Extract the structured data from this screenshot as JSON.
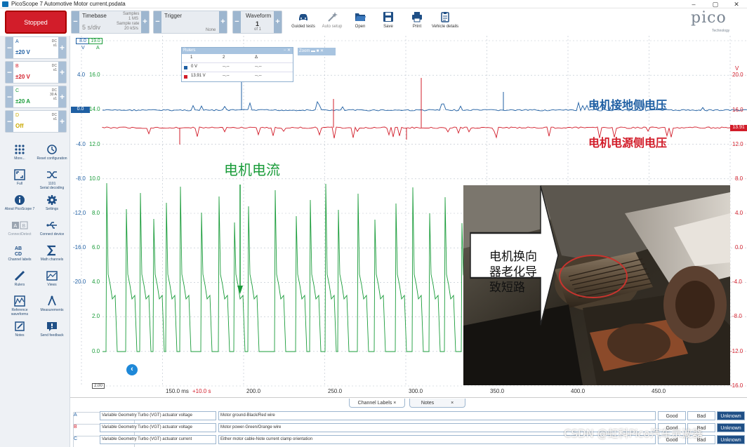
{
  "window": {
    "title": "PicoScope 7 Automotive Motor current.psdata",
    "minimize": "–",
    "maximize": "▢",
    "close": "✕"
  },
  "toolbar": {
    "stopped": "Stopped",
    "timebase": {
      "label": "Timebase",
      "value": "5 s/div",
      "samples_label": "Samples",
      "samples": "1 MS",
      "rate_label": "Sample rate",
      "rate": "20 kS/s"
    },
    "trigger": {
      "label": "Trigger",
      "mode": "None"
    },
    "waveform": {
      "label": "Waveform",
      "value": "1",
      "of": "of 1"
    },
    "buttons": [
      {
        "label": "Guided tests",
        "icon": "car-icon"
      },
      {
        "label": "Auto setup",
        "icon": "wand-icon"
      },
      {
        "label": "Open",
        "icon": "folder-icon"
      },
      {
        "label": "Save",
        "icon": "save-icon"
      },
      {
        "label": "Print",
        "icon": "print-icon"
      },
      {
        "label": "Vehicle details",
        "icon": "clipboard-icon"
      }
    ],
    "brand": "pico",
    "brand_sub": "Technology"
  },
  "channels": [
    {
      "name": "A",
      "coupling": "DC",
      "probe": "x1",
      "range": "±20 V",
      "color": "#1f5fa3"
    },
    {
      "name": "B",
      "coupling": "DC",
      "probe": "x1",
      "range": "±20 V",
      "color": "#d21d2a"
    },
    {
      "name": "C",
      "coupling": "DC",
      "probe": "30 A",
      "probe2": "x1",
      "range": "±20 A",
      "color": "#1a9c3a"
    },
    {
      "name": "D",
      "coupling": "DC",
      "probe": "x1",
      "range": "Off",
      "color": "#c9a800"
    }
  ],
  "sidebar": [
    {
      "label": "More...",
      "icon": "grid-icon"
    },
    {
      "label": "Reset configuration",
      "icon": "reset-icon"
    },
    {
      "label": "Full",
      "icon": "fullscreen-icon"
    },
    {
      "label": "Serial decoding",
      "icon": "serial-icon",
      "sub": "1101"
    },
    {
      "label": "About PicoScope 7",
      "icon": "info-icon"
    },
    {
      "label": "Settings",
      "icon": "gear-icon"
    },
    {
      "label": "ConnectDetect",
      "icon": "ab-icon"
    },
    {
      "label": "Connect device",
      "icon": "usb-icon"
    },
    {
      "label": "Channel labels",
      "icon": "abcd-icon"
    },
    {
      "label": "Math channels",
      "icon": "sigma-icon"
    },
    {
      "label": "Rulers",
      "icon": "ruler-icon"
    },
    {
      "label": "Views",
      "icon": "views-icon"
    },
    {
      "label": "Reference waveforms",
      "icon": "reference-icon"
    },
    {
      "label": "Measurements",
      "icon": "measure-icon"
    },
    {
      "label": "Notes",
      "icon": "notes-icon"
    },
    {
      "label": "Send feedback",
      "icon": "feedback-icon"
    }
  ],
  "scope": {
    "axis_a_header": "8.0",
    "axis_b_header": "19.0",
    "axis_a_unit": "V",
    "axis_b_unit": "A",
    "axis_a": [
      "4.0",
      "0.0",
      "-4.0",
      "-8.0",
      "-12.0",
      "-16.0",
      "-20.0"
    ],
    "axis_b": [
      "16.0",
      "14.0",
      "12.0",
      "10.0",
      "8.0",
      "6.0",
      "4.0",
      "2.0",
      "0.0"
    ],
    "axis_right": [
      "20.0",
      "16.0",
      "12.0",
      "8.0",
      "4.0",
      "0.0",
      "-4.0",
      "-8.0",
      "-12.0",
      "-16.0"
    ],
    "axis_right_unit": "V",
    "axis_right_values": {
      "top": "V",
      "marker": "13.91"
    },
    "axis_left_marker": "0.0",
    "x_ticks": [
      "150.0 ms",
      "+10.0 s",
      "200.0",
      "250.0",
      "300.0",
      "350.0",
      "400.0",
      "450.0"
    ],
    "x_start": "2.00"
  },
  "rulers": {
    "title": "Rulers",
    "cols": [
      "1",
      "2",
      "Δ"
    ],
    "rows": [
      {
        "v1": "0 V",
        "v2": "--.--",
        "d": "--.--"
      },
      {
        "v1": "13.91 V",
        "v2": "--.--",
        "d": "--.--"
      }
    ]
  },
  "zoom": {
    "title": "Zoom"
  },
  "annotations": {
    "a_label": "电机接地侧电压",
    "b_label": "电机电源侧电压",
    "c_label": "电机电流",
    "photo_text": "电机换向器老化导致短路"
  },
  "tabs": {
    "channel_labels": "Channel Labels",
    "notes": "Notes"
  },
  "labels": [
    {
      "ch": "A",
      "sel": "Variable Geometry Turbo (VGT) actuator voltage",
      "note": "Motor ground-Black/Red wire"
    },
    {
      "ch": "B",
      "sel": "Variable Geometry Turbo (VGT) actuator voltage",
      "note": "Motor power-Green/Orange wire"
    },
    {
      "ch": "C",
      "sel": "Variable Geometry Turbo (VGT) actuator current",
      "note": "Either motor cable-Note current clamp orientation"
    }
  ],
  "rating": [
    "Good",
    "Bad",
    "Unknown"
  ],
  "watermark": "CSDN @虹科Pico汽车示波器"
}
